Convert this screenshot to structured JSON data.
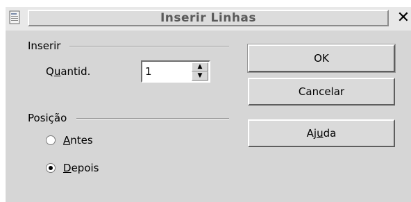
{
  "window": {
    "title": "Inserir Linhas",
    "close_symbol": "✕",
    "icon": "document-icon"
  },
  "insert_group": {
    "label": "Inserir",
    "quantity_label_pre": "Q",
    "quantity_label_underlined": "u",
    "quantity_label_post": "antid.",
    "quantity_value": "1",
    "spin_up": "▲",
    "spin_down": "▼"
  },
  "position_group": {
    "label": "Posição",
    "options": [
      {
        "label_underlined": "A",
        "label_rest": "ntes",
        "checked": false
      },
      {
        "label_underlined": "D",
        "label_rest": "epois",
        "checked": true
      }
    ]
  },
  "buttons": {
    "ok": "OK",
    "cancel": "Cancelar",
    "help_pre": "Aj",
    "help_underlined": "u",
    "help_post": "da"
  }
}
